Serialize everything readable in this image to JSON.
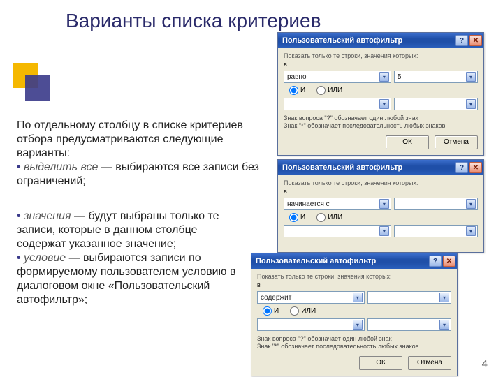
{
  "slide": {
    "title": "Варианты списка критериев",
    "page_number": "4"
  },
  "text": {
    "para1_line1": "По отдельному столбцу в списке критериев отбора предусматриваются следующие варианты:",
    "bullet1_term": "выделить все",
    "bullet1_rest": " — выбираются все записи без ограничений;",
    "bullet2_term": "значения",
    "bullet2_rest": " — будут выбраны только те записи, которые в данном столбце содержат указанное значение;",
    "bullet3_term": "условие",
    "bullet3_rest": " — выбираются записи по формируемому пользователем условию в диалоговом окне «Пользовательский автофильтр»;"
  },
  "dialog": {
    "title": "Пользовательский автофильтр",
    "hint": "Показать только те строки, значения которых:",
    "field_label": "в",
    "op_equals": "равно",
    "op_starts": "начинается с",
    "op_contains": "содержит",
    "value_5": "5",
    "radio_and": "И",
    "radio_or": "ИЛИ",
    "note_line1": "Знак вопроса \"?\" обозначает один любой знак",
    "note_line2": "Знак \"*\" обозначает последовательность любых знаков",
    "btn_ok": "ОК",
    "btn_cancel": "Отмена"
  }
}
